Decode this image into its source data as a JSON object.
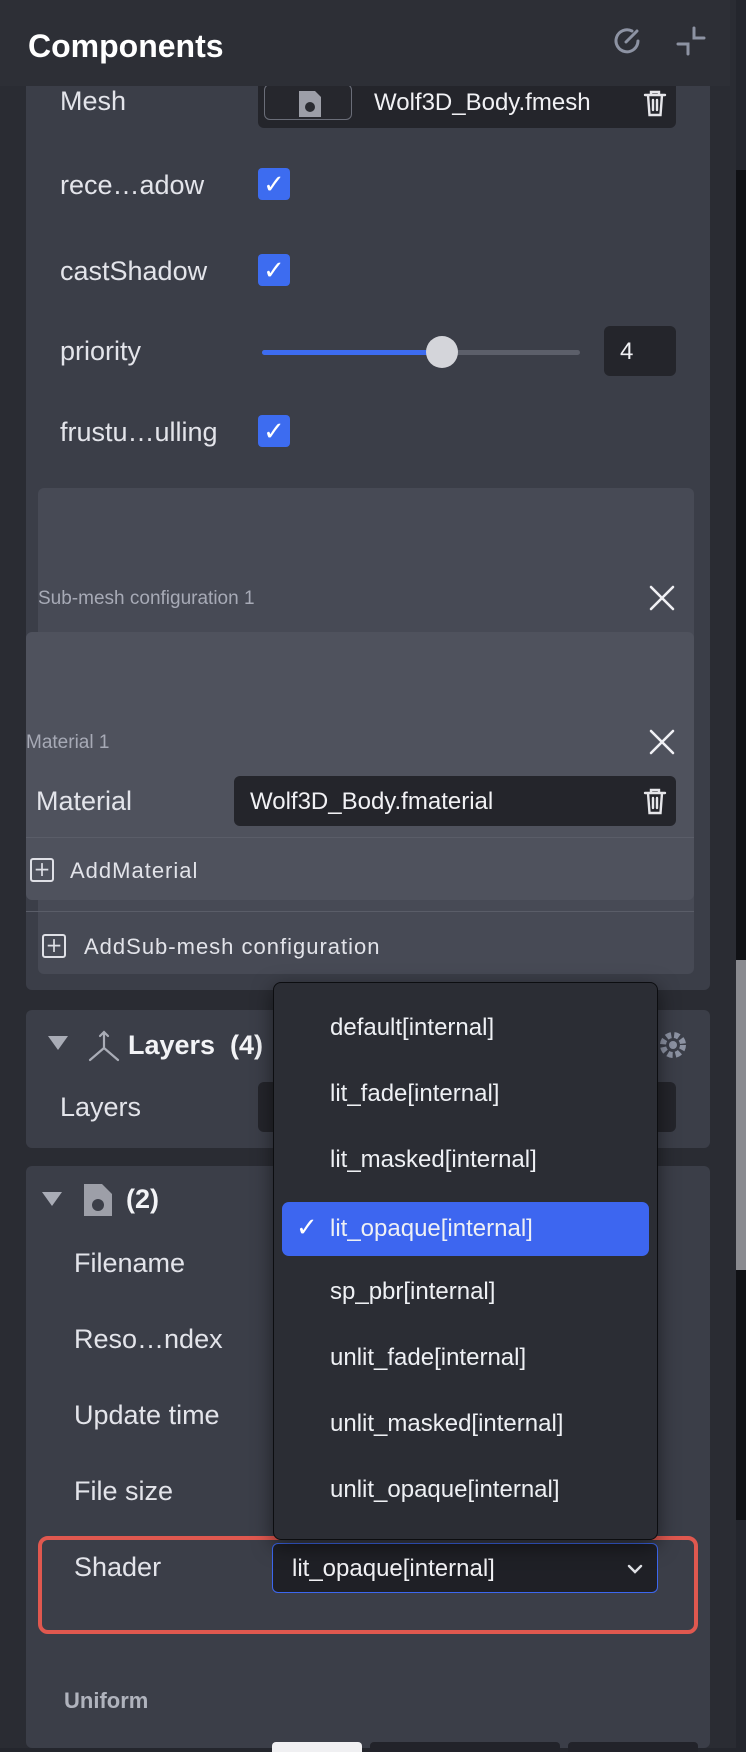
{
  "panel": {
    "title": "Components",
    "header_icons": [
      "refresh-icon",
      "collapse-icon"
    ]
  },
  "mesh_renderer": {
    "mesh_label": "Mesh",
    "mesh_value": "Wolf3D_Body.fmesh",
    "receive_shadow_label": "rece…adow",
    "receive_shadow_checked": true,
    "cast_shadow_label": "castShadow",
    "cast_shadow_checked": true,
    "priority_label": "priority",
    "priority_value": "4",
    "priority_slider_fraction": 0.56,
    "frustum_label": "frustu…ulling",
    "frustum_checked": true
  },
  "submesh": {
    "title": "Sub-mesh configuration 1",
    "material_card_title": "Material 1",
    "material_label": "Material",
    "material_value": "Wolf3D_Body.fmaterial",
    "add_material_label": "AddMaterial",
    "add_submesh_label": "AddSub-mesh configuration"
  },
  "layers": {
    "title": "Layers",
    "count": "(4)",
    "row_label": "Layers"
  },
  "material_component": {
    "count": "(2)",
    "filename_label": "Filename",
    "resource_index_label": "Reso…ndex",
    "update_time_label": "Update time",
    "file_size_label": "File size",
    "shader_label": "Shader",
    "shader_value": "lit_opaque[internal]",
    "uniform_label": "Uniform"
  },
  "shader_dropdown": {
    "options": [
      "default[internal]",
      "lit_fade[internal]",
      "lit_masked[internal]",
      "lit_opaque[internal]",
      "sp_pbr[internal]",
      "unlit_fade[internal]",
      "unlit_masked[internal]",
      "unlit_opaque[internal]"
    ],
    "selected": "lit_opaque[internal]"
  },
  "colors": {
    "accent": "#3d66f0",
    "highlight_border": "#e0584f",
    "panel_bg": "#2a2c33",
    "card_bg": "#3b3e48"
  }
}
